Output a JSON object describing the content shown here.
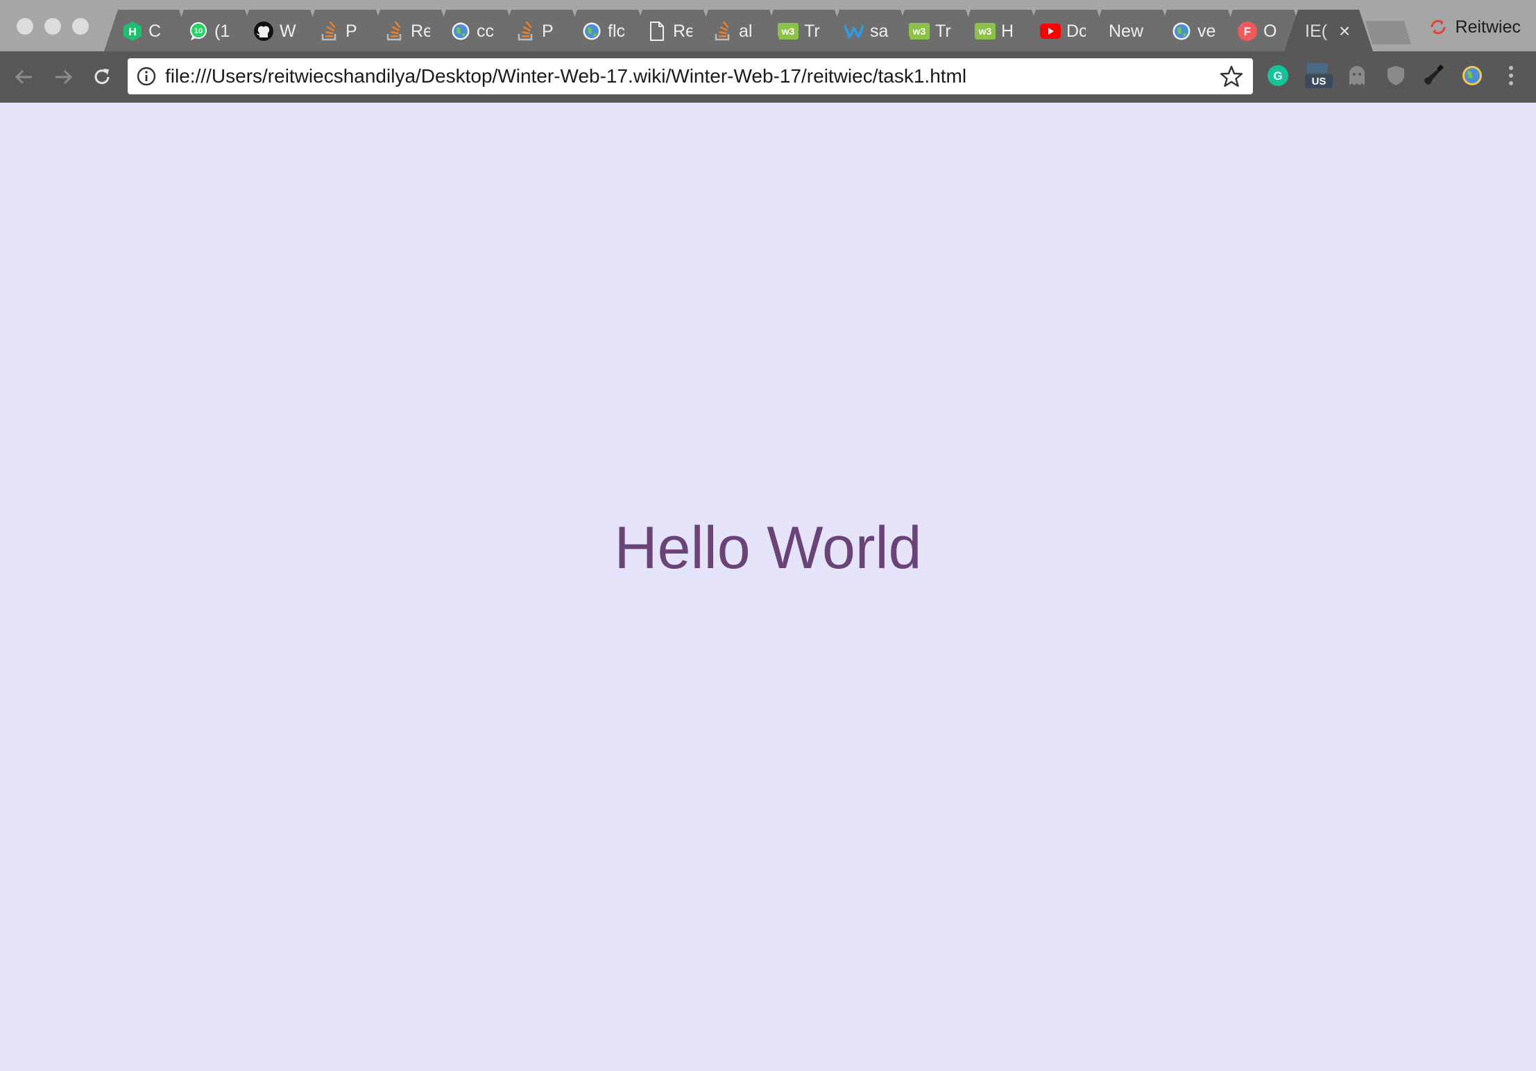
{
  "window": {
    "profile_name": "Reitwiec"
  },
  "tabs": [
    {
      "title": "C",
      "icon": "hexagon-h-icon",
      "icon_color": "#1cc16e",
      "icon_text": "H"
    },
    {
      "title": "(1",
      "icon": "whatsapp-icon",
      "icon_color": "#25d366",
      "icon_text": "10"
    },
    {
      "title": "W",
      "icon": "github-icon",
      "icon_color": "#1b1b1b",
      "icon_text": ""
    },
    {
      "title": "P",
      "icon": "stackoverflow-icon",
      "icon_color": "#f48024",
      "icon_text": ""
    },
    {
      "title": "Re",
      "icon": "stackoverflow-icon",
      "icon_color": "#f48024",
      "icon_text": ""
    },
    {
      "title": "cc",
      "icon": "globe-icon",
      "icon_color": "#4a90d9",
      "icon_text": ""
    },
    {
      "title": "P",
      "icon": "stackoverflow-icon",
      "icon_color": "#f48024",
      "icon_text": ""
    },
    {
      "title": "flc",
      "icon": "globe-icon",
      "icon_color": "#4a90d9",
      "icon_text": ""
    },
    {
      "title": "Re",
      "icon": "document-icon",
      "icon_color": "#ffffff",
      "icon_text": ""
    },
    {
      "title": "al",
      "icon": "stackoverflow-icon",
      "icon_color": "#f48024",
      "icon_text": ""
    },
    {
      "title": "Tr",
      "icon": "w3schools-icon",
      "icon_color": "#8bc34a",
      "icon_text": "w3"
    },
    {
      "title": "sa",
      "icon": "weebly-icon",
      "icon_color": "#2d9cdb",
      "icon_text": "W"
    },
    {
      "title": "Tr",
      "icon": "w3schools-icon",
      "icon_color": "#8bc34a",
      "icon_text": "w3"
    },
    {
      "title": "H",
      "icon": "w3schools-icon",
      "icon_color": "#8bc34a",
      "icon_text": "w3"
    },
    {
      "title": "Dc",
      "icon": "youtube-icon",
      "icon_color": "#ff0000",
      "icon_text": "▶"
    },
    {
      "title": "New",
      "icon": "",
      "icon_color": "",
      "icon_text": ""
    },
    {
      "title": "ve",
      "icon": "globe-icon",
      "icon_color": "#4a90d9",
      "icon_text": ""
    },
    {
      "title": "O",
      "icon": "f-circle-icon",
      "icon_color": "#f25a5a",
      "icon_text": "F"
    },
    {
      "title": "IE(",
      "icon": "",
      "icon_color": "",
      "icon_text": "",
      "active": true,
      "close_label": "×"
    }
  ],
  "toolbar": {
    "url": "file:///Users/reitwiecshandilya/Desktop/Winter-Web-17.wiki/Winter-Web-17/reitwiec/task1.html",
    "extensions": [
      {
        "name": "grammarly-icon",
        "color": "#15c39a",
        "text": "G"
      },
      {
        "name": "us-flag-icon",
        "color": "#3b4a5c",
        "text": "US"
      },
      {
        "name": "ghostery-icon",
        "color": "#8a8a8a",
        "text": ""
      },
      {
        "name": "shield-icon",
        "color": "#8a8a8a",
        "text": ""
      },
      {
        "name": "guitar-icon",
        "color": "#222222",
        "text": ""
      },
      {
        "name": "globe-icon",
        "color": "#4a90d9",
        "text": ""
      },
      {
        "name": "menu-kebab-icon",
        "color": "#bdbdbd",
        "text": "⋮"
      }
    ]
  },
  "page": {
    "heading": "Hello World",
    "heading_color": "#6a4478",
    "background_color": "#e5e4fa"
  }
}
